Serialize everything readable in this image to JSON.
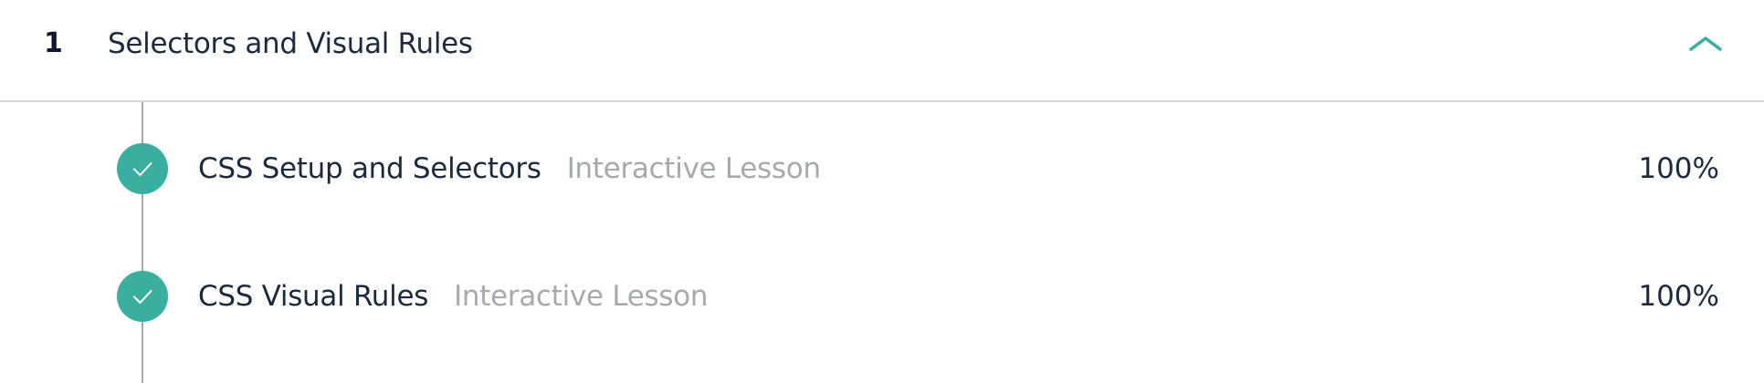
{
  "module": {
    "number": "1",
    "title": "Selectors and Visual Rules",
    "toggle_icon": "chevron-up-icon",
    "accent_color": "#3aafa0"
  },
  "lessons": [
    {
      "title": "CSS Setup and Selectors",
      "type": "Interactive Lesson",
      "progress": "100%",
      "status_icon": "check-icon",
      "completed": true
    },
    {
      "title": "CSS Visual Rules",
      "type": "Interactive Lesson",
      "progress": "100%",
      "status_icon": "check-icon",
      "completed": true
    }
  ]
}
